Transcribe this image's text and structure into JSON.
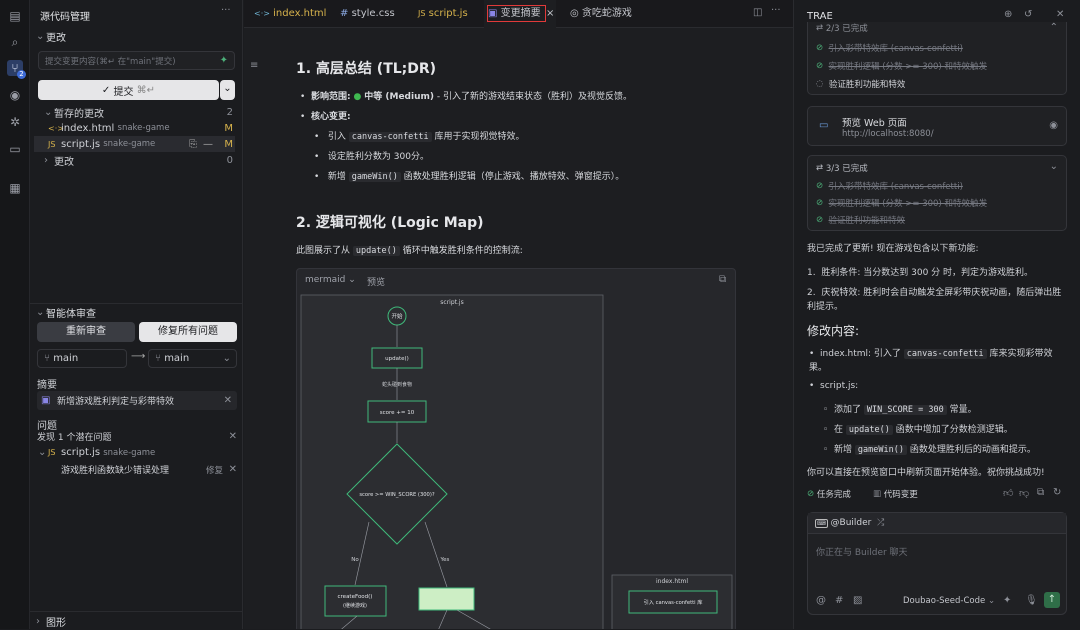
{
  "activity": {
    "icons": [
      "files-icon",
      "search-icon",
      "source-control-icon",
      "preview-icon",
      "debug-icon",
      "remote-icon",
      "extensions-icon"
    ],
    "scm_badge": "2"
  },
  "scm": {
    "title": "源代码管理",
    "changes_header": "更改",
    "commit_placeholder": "提交变更内容(⌘↵ 在\"main\"提交)",
    "commit_button": "提交",
    "commit_shortcut": "⌘↵",
    "staged_header": "暂存的更改",
    "staged_count": "2",
    "files": [
      {
        "icon": "<·>",
        "name": "index.html",
        "folder": "snake-game",
        "status": "M"
      },
      {
        "icon": "JS",
        "name": "script.js",
        "folder": "snake-game",
        "status": "M"
      }
    ],
    "unstaged_header": "更改",
    "unstaged_count": "0",
    "agent": {
      "header": "智能体审查",
      "rereview": "重新审查",
      "fix_all": "修复所有问题",
      "branch_from": "main",
      "branch_to": "main",
      "summary_label": "摘要",
      "summary_text": "新增游戏胜利判定与彩带特效",
      "issues_label": "问题",
      "issues_found": "发现 1 个潜在问题",
      "issue_file": "script.js",
      "issue_folder": "snake-game",
      "issue_text": "游戏胜利函数缺少错误处理",
      "issue_fix": "修复"
    },
    "graph_header": "图形"
  },
  "editor": {
    "tabs": [
      {
        "icon": "<·>",
        "label": "index.html",
        "color": "#d6b24c"
      },
      {
        "icon": "#",
        "label": "style.css",
        "color": "#8aa8e0"
      },
      {
        "icon": "JS",
        "label": "script.js",
        "color": "#d6b24c"
      },
      {
        "icon": "▣",
        "label": "变更摘要",
        "color": "#c6c8d0"
      },
      {
        "icon": "◎",
        "label": "贪吃蛇游戏",
        "color": "#9a9da5"
      }
    ],
    "h1": "1. 高层总结 (TL;DR)",
    "impact_label": "影响范围:",
    "impact_level": "中等 (Medium)",
    "impact_desc": "- 引入了新的游戏结束状态（胜利）及视觉反馈。",
    "core_label": "核心变更:",
    "core": [
      {
        "pre": "引入",
        "code": "canvas-confetti",
        "post": "库用于实现视觉特效。"
      },
      {
        "pre": "设定胜利分数为 300分。",
        "code": "",
        "post": ""
      },
      {
        "pre": "新增",
        "code": "gameWin()",
        "post": "函数处理胜利逻辑（停止游戏、播放特效、弹窗提示）。"
      }
    ],
    "h2": "2. 逻辑可视化 (Logic Map)",
    "flow_pre": "此图展示了从",
    "flow_code": "update()",
    "flow_post": "循环中触发胜利条件的控制流:",
    "mermaid_tab": "mermaid",
    "preview_tab": "预览",
    "diagram": {
      "group_left": "script.js",
      "start": "开始",
      "update": "update()",
      "eat": "蛇头碰到食物",
      "score": "score += 10",
      "decision": "score >= WIN_SCORE (300)?",
      "no": "No",
      "yes": "Yes",
      "create_food": "createFood()",
      "create_food_sub": "(继续游戏)",
      "group_right": "index.html",
      "confetti": "引入 canvas-confetti 库"
    }
  },
  "trae": {
    "title": "TRAE",
    "card1": {
      "header": "2/3 已完成",
      "items": [
        "引入彩带特效库 (canvas-confetti)",
        "实现胜利逻辑 (分数 >= 300) 和特效触发",
        "验证胜利功能和特效"
      ]
    },
    "preview": {
      "title": "预览 Web 页面",
      "url": "http://localhost:8080/"
    },
    "card2": {
      "header": "3/3 已完成",
      "items": [
        "引入彩带特效库 (canvas-confetti)",
        "实现胜利逻辑 (分数 >= 300) 和特效触发",
        "验证胜利功能和特效"
      ]
    },
    "intro": "我已完成了更新! 现在游戏包含以下新功能:",
    "features": [
      {
        "num": "1.",
        "label": "胜利条件:",
        "text": "当分数达到 300 分 时，判定为游戏胜利。"
      },
      {
        "num": "2.",
        "label": "庆祝特效:",
        "text": "胜利时会自动触发全屏彩带庆祝动画，随后弹出胜利提示。"
      }
    ],
    "mods_title": "修改内容:",
    "mod_index_pre": "index.html: 引入了",
    "mod_index_code": "canvas-confetti",
    "mod_index_post": "库来实现彩带效果。",
    "mod_script": "script.js:",
    "sub": [
      {
        "pre": "添加了",
        "code": "WIN_SCORE = 300",
        "post": "常量。"
      },
      {
        "pre": "在",
        "code": "update()",
        "post": "函数中增加了分数检测逻辑。"
      },
      {
        "pre": "新增",
        "code": "gameWin()",
        "post": "函数处理胜利后的动画和提示。"
      }
    ],
    "closing": "你可以直接在预览窗口中刷新页面开始体验。祝你挑战成功!",
    "task_done": "任务完成",
    "code_changes": "代码变更",
    "agent": "@Builder",
    "chat_placeholder": "你正在与 Builder 聊天",
    "model": "Doubao-Seed-Code"
  }
}
